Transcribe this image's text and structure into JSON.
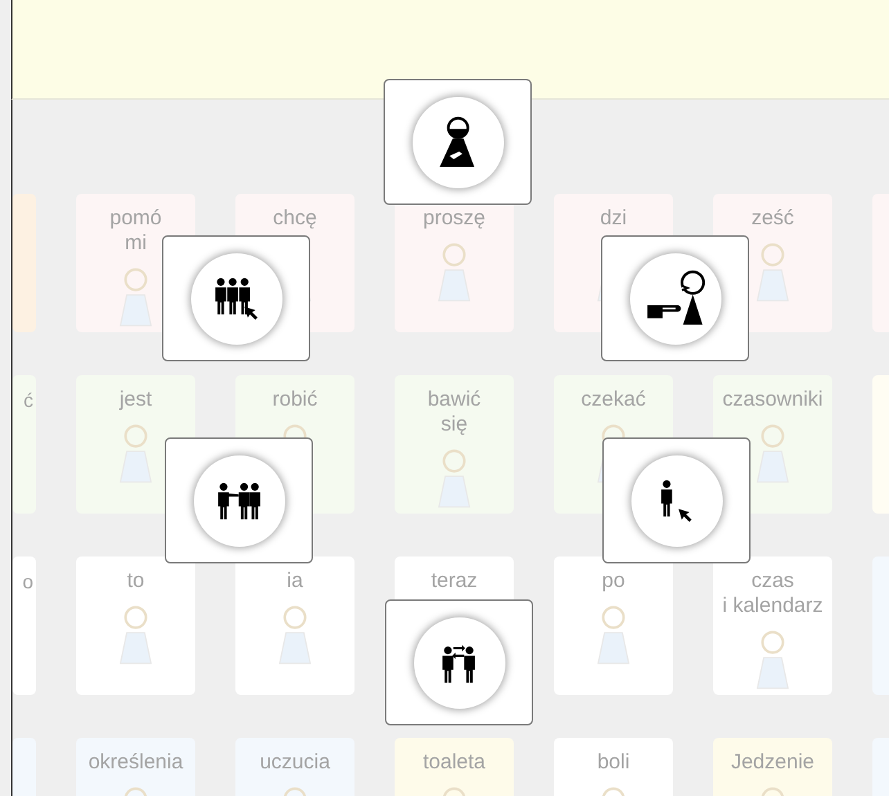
{
  "grid": {
    "rows": [
      {
        "cells": [
          {
            "color": "#fdf1e2"
          },
          {
            "lines": [
              "pomó",
              "mi"
            ],
            "color": "#fdf5f5"
          },
          {
            "lines": [
              "chcę"
            ],
            "color": "#fdf5f5"
          },
          {
            "lines": [
              "proszę"
            ],
            "color": "#fdf5f5"
          },
          {
            "lines": [
              "dzi"
            ],
            "color": "#fdf5f5"
          },
          {
            "lines": [
              "ześć"
            ],
            "color": "#fdf5f5"
          },
          {
            "color": "#fdf5f5"
          }
        ]
      },
      {
        "cells": [
          {
            "lines": [
              "ć"
            ],
            "color": "#f5faf0"
          },
          {
            "lines": [
              "jest"
            ],
            "color": "#f5faf0"
          },
          {
            "lines": [
              "robić"
            ],
            "color": "#f5faf0"
          },
          {
            "lines": [
              "bawić",
              "się"
            ],
            "color": "#f5faf0"
          },
          {
            "lines": [
              "czekać"
            ],
            "color": "#f5faf0"
          },
          {
            "lines": [
              "czasowniki"
            ],
            "color": "#f5faf0"
          },
          {
            "color": "#fffdf3"
          }
        ]
      },
      {
        "cells": [
          {
            "lines": [
              "o"
            ],
            "color": "#ffffff"
          },
          {
            "lines": [
              "to"
            ],
            "color": "#ffffff"
          },
          {
            "lines": [
              "ia"
            ],
            "color": "#ffffff"
          },
          {
            "lines": [
              "teraz"
            ],
            "color": "#ffffff"
          },
          {
            "lines": [
              "po"
            ],
            "color": "#ffffff"
          },
          {
            "lines": [
              "czas",
              "i kalendarz"
            ],
            "color": "#ffffff"
          },
          {
            "color": "#f3f8fd"
          }
        ]
      },
      {
        "cells": [
          {
            "color": "#f3f8fd"
          },
          {
            "lines": [
              "określenia"
            ],
            "color": "#f3f8fd"
          },
          {
            "lines": [
              "uczucia"
            ],
            "color": "#f3f8fd"
          },
          {
            "lines": [
              "toaleta"
            ],
            "color": "#fefbea"
          },
          {
            "lines": [
              "boli"
            ],
            "color": "#ffffff"
          },
          {
            "lines": [
              "Jedzenie"
            ],
            "color": "#fefbea"
          },
          {
            "color": "#f3f8fd"
          }
        ]
      }
    ]
  },
  "popup": {
    "options": [
      {
        "kind": "me"
      },
      {
        "kind": "we"
      },
      {
        "kind": "you"
      },
      {
        "kind": "you_plural"
      },
      {
        "kind": "he"
      },
      {
        "kind": "each_other"
      }
    ]
  }
}
